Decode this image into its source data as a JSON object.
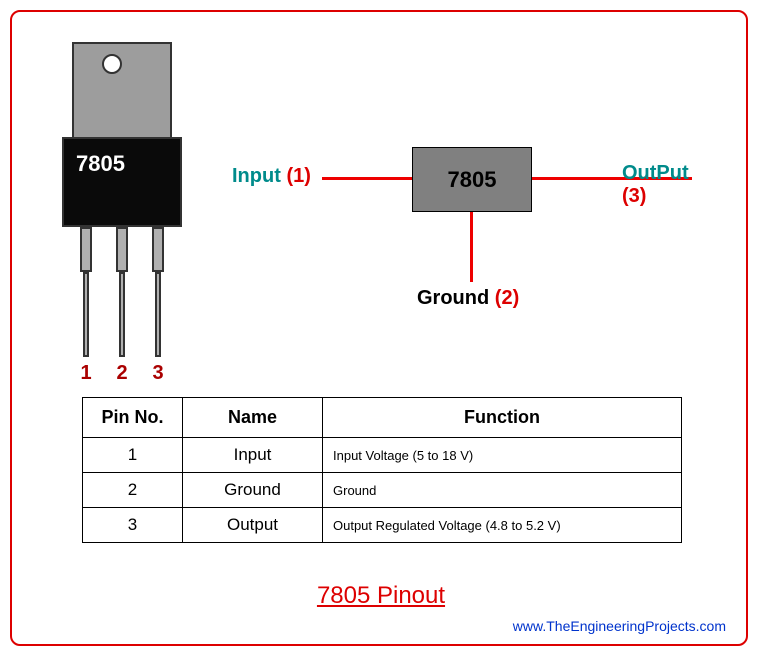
{
  "chip_label": "7805",
  "pin_numbers": {
    "p1": "1",
    "p2": "2",
    "p3": "3"
  },
  "schematic": {
    "box_label": "7805",
    "input_label": "Input",
    "input_num": "(1)",
    "output_label": "OutPut",
    "output_num": "(3)",
    "ground_label": "Ground",
    "ground_num": "(2)"
  },
  "table": {
    "headers": {
      "pin": "Pin No.",
      "name": "Name",
      "fn": "Function"
    },
    "rows": [
      {
        "no": "1",
        "name": "Input",
        "fn": "Input Voltage (5 to 18 V)"
      },
      {
        "no": "2",
        "name": "Ground",
        "fn": "Ground"
      },
      {
        "no": "3",
        "name": "Output",
        "fn": "Output Regulated Voltage (4.8 to 5.2 V)"
      }
    ]
  },
  "title": "7805 Pinout",
  "watermark": "www.TheEngineeringProjects.com"
}
